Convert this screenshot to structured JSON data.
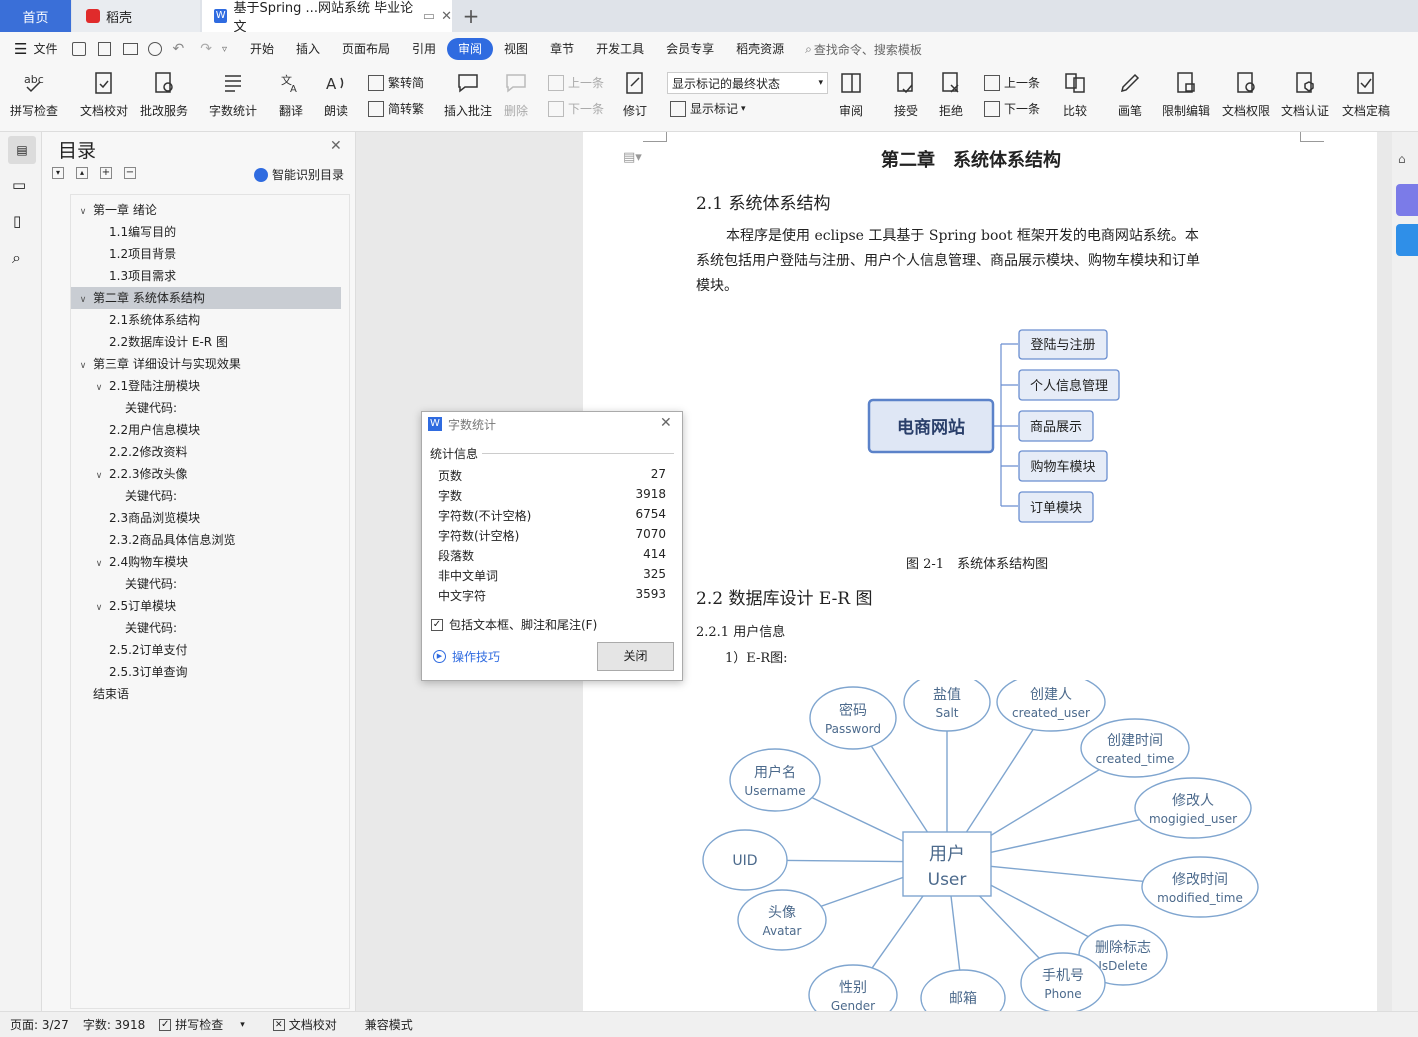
{
  "tabs": {
    "home": "首页",
    "daoke": "稻壳",
    "doc": "基于Spring ...网站系统 毕业论文"
  },
  "menus": [
    "文件",
    "开始",
    "插入",
    "页面布局",
    "引用",
    "审阅",
    "视图",
    "章节",
    "开发工具",
    "会员专享",
    "稻壳资源"
  ],
  "search_placeholder": "查找命令、搜索模板",
  "ribbon": {
    "spellcheck": "拼写检查",
    "doc_proof": "文档校对",
    "revise_service": "批改服务",
    "word_count": "字数统计",
    "translate": "翻译",
    "read_aloud": "朗读",
    "to_traditional": "繁转简",
    "to_simplified": "简转繁",
    "insert_comment": "插入批注",
    "delete": "删除",
    "prev": "上一条",
    "next": "下一条",
    "track_changes": "修订",
    "show_markup_select": "显示标记的最终状态",
    "show_markup": "显示标记",
    "review": "审阅",
    "accept": "接受",
    "reject": "拒绝",
    "prev2": "上一条",
    "next2": "下一条",
    "compare": "比较",
    "pen": "画笔",
    "restrict_edit": "限制编辑",
    "doc_rights": "文档权限",
    "doc_auth": "文档认证",
    "doc_final": "文档定稿"
  },
  "toc": {
    "title": "目录",
    "smart": "智能识别目录",
    "items": [
      "第一章 绪论",
      "1.1编写目的",
      "1.2项目背景",
      "1.3项目需求",
      "第二章 系统体系结构",
      "2.1系统体系结构",
      "2.2数据库设计 E-R 图",
      "第三章 详细设计与实现效果",
      "2.1登陆注册模块",
      "关键代码:",
      "2.2用户信息模块",
      "2.2.2修改资料",
      "2.2.3修改头像",
      "关键代码:",
      "2.3商品浏览模块",
      "2.3.2商品具体信息浏览",
      "2.4购物车模块",
      "关键代码:",
      "2.5订单模块",
      "关键代码:",
      "2.5.2订单支付",
      "2.5.3订单查询",
      "结束语"
    ]
  },
  "doc": {
    "chapter": "第二章　系统体系结构",
    "h21": "2.1 系统体系结构",
    "para1": "本程序是使用 eclipse 工具基于 Spring boot 框架开发的电商网站系统。本",
    "para2": "系统包括用户登陆与注册、用户个人信息管理、商品展示模块、购物车模块和订单",
    "para3": "模块。",
    "mm_root": "电商网站",
    "mm_nodes": [
      "登陆与注册",
      "个人信息管理",
      "商品展示",
      "购物车模块",
      "订单模块"
    ],
    "fig_caption": "图 2-1　系统体系结构图",
    "h22": "2.2 数据库设计 E-R 图",
    "h221": "2.2.1 用户信息",
    "er_label": "1）E-R图:",
    "er_center": [
      "用户",
      "User"
    ],
    "er_attrs": [
      [
        "密码",
        "Password"
      ],
      [
        "盐值",
        "Salt"
      ],
      [
        "创建人",
        "created_user"
      ],
      [
        "创建时间",
        "created_time"
      ],
      [
        "用户名",
        "Username"
      ],
      [
        "修改人",
        "mogigied_user"
      ],
      [
        "UID",
        ""
      ],
      [
        "修改时间",
        "modified_time"
      ],
      [
        "头像",
        "Avatar"
      ],
      [
        "删除标志",
        "IsDelete"
      ],
      [
        "性别",
        "Gender"
      ],
      [
        "邮箱",
        ""
      ],
      [
        "手机号",
        "Phone"
      ]
    ]
  },
  "dialog": {
    "title": "字数统计",
    "section": "统计信息",
    "rows": [
      [
        "页数",
        "27"
      ],
      [
        "字数",
        "3918"
      ],
      [
        "字符数(不计空格)",
        "6754"
      ],
      [
        "字符数(计空格)",
        "7070"
      ],
      [
        "段落数",
        "414"
      ],
      [
        "非中文单词",
        "325"
      ],
      [
        "中文字符",
        "3593"
      ]
    ],
    "checkbox": "包括文本框、脚注和尾注(F)",
    "tips": "操作技巧",
    "close": "关闭"
  },
  "status": {
    "page": "页面: 3/27",
    "words": "字数: 3918",
    "spell": "拼写检查",
    "proof": "文档校对",
    "compat": "兼容模式"
  }
}
